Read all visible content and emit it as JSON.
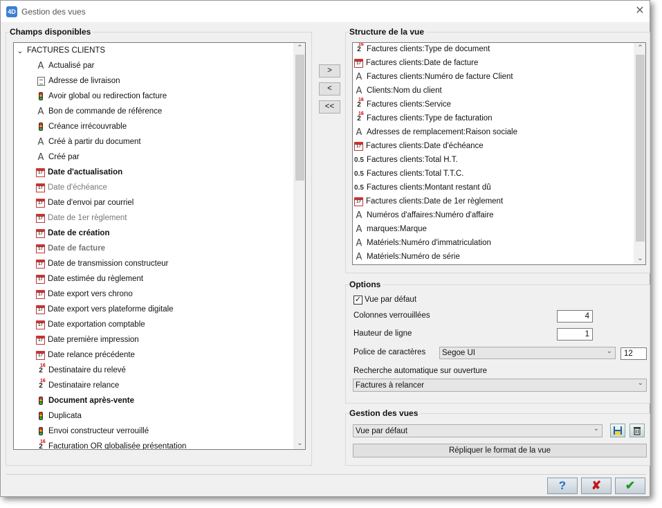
{
  "window": {
    "title": "Gestion des vues",
    "app_badge": "4D",
    "close_glyph": "✕"
  },
  "available": {
    "label": "Champs disponibles",
    "root": "FACTURES CLIENTS",
    "items": [
      {
        "label": "Actualisé par",
        "icon": "text-field-icon",
        "style": "normal"
      },
      {
        "label": "Adresse de livraison",
        "icon": "memo-field-icon",
        "style": "normal"
      },
      {
        "label": "Avoir global ou redirection facture",
        "icon": "boolean-field-icon",
        "style": "normal"
      },
      {
        "label": "Bon de commande de référence",
        "icon": "text-field-icon",
        "style": "normal"
      },
      {
        "label": "Créance irrécouvrable",
        "icon": "boolean-field-icon",
        "style": "normal"
      },
      {
        "label": "Créé à partir du document",
        "icon": "text-field-icon",
        "style": "normal"
      },
      {
        "label": "Créé par",
        "icon": "text-field-icon",
        "style": "normal"
      },
      {
        "label": "Date d'actualisation",
        "icon": "date-field-icon",
        "style": "bold"
      },
      {
        "label": "Date d'échéance",
        "icon": "date-field-icon",
        "style": "gray"
      },
      {
        "label": "Date d'envoi par courriel",
        "icon": "date-field-icon",
        "style": "normal"
      },
      {
        "label": "Date de 1er règlement",
        "icon": "date-field-icon",
        "style": "gray"
      },
      {
        "label": "Date de création",
        "icon": "date-field-icon",
        "style": "bold"
      },
      {
        "label": "Date de facture",
        "icon": "date-field-icon",
        "style": "bold-gray"
      },
      {
        "label": "Date de transmission constructeur",
        "icon": "date-field-icon",
        "style": "normal"
      },
      {
        "label": "Date estimée du règlement",
        "icon": "date-field-icon",
        "style": "normal"
      },
      {
        "label": "Date export vers chrono",
        "icon": "date-field-icon",
        "style": "normal"
      },
      {
        "label": "Date export vers plateforme digitale",
        "icon": "date-field-icon",
        "style": "normal"
      },
      {
        "label": "Date exportation comptable",
        "icon": "date-field-icon",
        "style": "normal"
      },
      {
        "label": "Date première impression",
        "icon": "date-field-icon",
        "style": "normal"
      },
      {
        "label": "Date relance précédente",
        "icon": "date-field-icon",
        "style": "normal"
      },
      {
        "label": "Destinataire du relevé",
        "icon": "integer-field-icon",
        "style": "normal"
      },
      {
        "label": "Destinataire relance",
        "icon": "integer-field-icon",
        "style": "normal"
      },
      {
        "label": "Document après-vente",
        "icon": "boolean-field-icon",
        "style": "bold"
      },
      {
        "label": "Duplicata",
        "icon": "boolean-field-icon",
        "style": "normal"
      },
      {
        "label": "Envoi constructeur verrouillé",
        "icon": "boolean-field-icon",
        "style": "normal"
      },
      {
        "label": "Facturation OR globalisée présentation",
        "icon": "integer-field-icon",
        "style": "normal"
      }
    ]
  },
  "move_buttons": {
    "add": ">",
    "remove": "<",
    "remove_all": "<<"
  },
  "structure": {
    "label": "Structure de la vue",
    "items": [
      {
        "label": "Factures clients:Type de document",
        "icon": "integer-field-icon"
      },
      {
        "label": "Factures clients:Date de facture",
        "icon": "date-field-icon"
      },
      {
        "label": "Factures clients:Numéro de facture Client",
        "icon": "text-field-icon"
      },
      {
        "label": "Clients:Nom du client",
        "icon": "text-field-icon"
      },
      {
        "label": "Factures clients:Service",
        "icon": "integer-field-icon"
      },
      {
        "label": "Factures clients:Type de facturation",
        "icon": "integer-field-icon"
      },
      {
        "label": "Adresses de remplacement:Raison sociale",
        "icon": "text-field-icon"
      },
      {
        "label": "Factures clients:Date d'échéance",
        "icon": "date-field-icon"
      },
      {
        "label": "Factures clients:Total H.T.",
        "icon": "real-field-icon"
      },
      {
        "label": "Factures clients:Total T.T.C.",
        "icon": "real-field-icon"
      },
      {
        "label": "Factures clients:Montant restant dû",
        "icon": "real-field-icon"
      },
      {
        "label": "Factures clients:Date de 1er règlement",
        "icon": "date-field-icon"
      },
      {
        "label": "Numéros d'affaires:Numéro d'affaire",
        "icon": "text-field-icon"
      },
      {
        "label": "marques:Marque",
        "icon": "text-field-icon"
      },
      {
        "label": "Matériels:Numéro d'immatriculation",
        "icon": "text-field-icon"
      },
      {
        "label": "Matériels:Numéro de série",
        "icon": "text-field-icon"
      }
    ]
  },
  "options": {
    "label": "Options",
    "default_view_label": "Vue par défaut",
    "default_view_checked": true,
    "locked_columns_label": "Colonnes verrouillées",
    "locked_columns_value": "4",
    "row_height_label": "Hauteur de ligne",
    "row_height_value": "1",
    "font_label": "Police de caractères",
    "font_value": "Segoe UI",
    "font_size_value": "12",
    "auto_search_label": "Recherche automatique sur ouverture",
    "auto_search_value": "Factures à relancer"
  },
  "views": {
    "label": "Gestion des vues",
    "selected": "Vue par défaut",
    "replicate_label": "Répliquer le format de la vue"
  },
  "footer": {
    "help": "?",
    "cancel": "✘",
    "ok": "✔"
  },
  "icon_glyphs": {
    "text": "A",
    "cal_day": "17",
    "int_base": "2",
    "int_sup": "16",
    "real": "0.5",
    "check": "✓",
    "scroll_up": "⌃",
    "scroll_down": "⌄",
    "combo_chevron": "⌄",
    "tree_toggle": "⌄"
  },
  "colors": {
    "window_bg": "#f0f0f0",
    "ok_green": "#1d9a1d",
    "cancel_red": "#c0161b",
    "help_blue": "#1f6fc9"
  }
}
